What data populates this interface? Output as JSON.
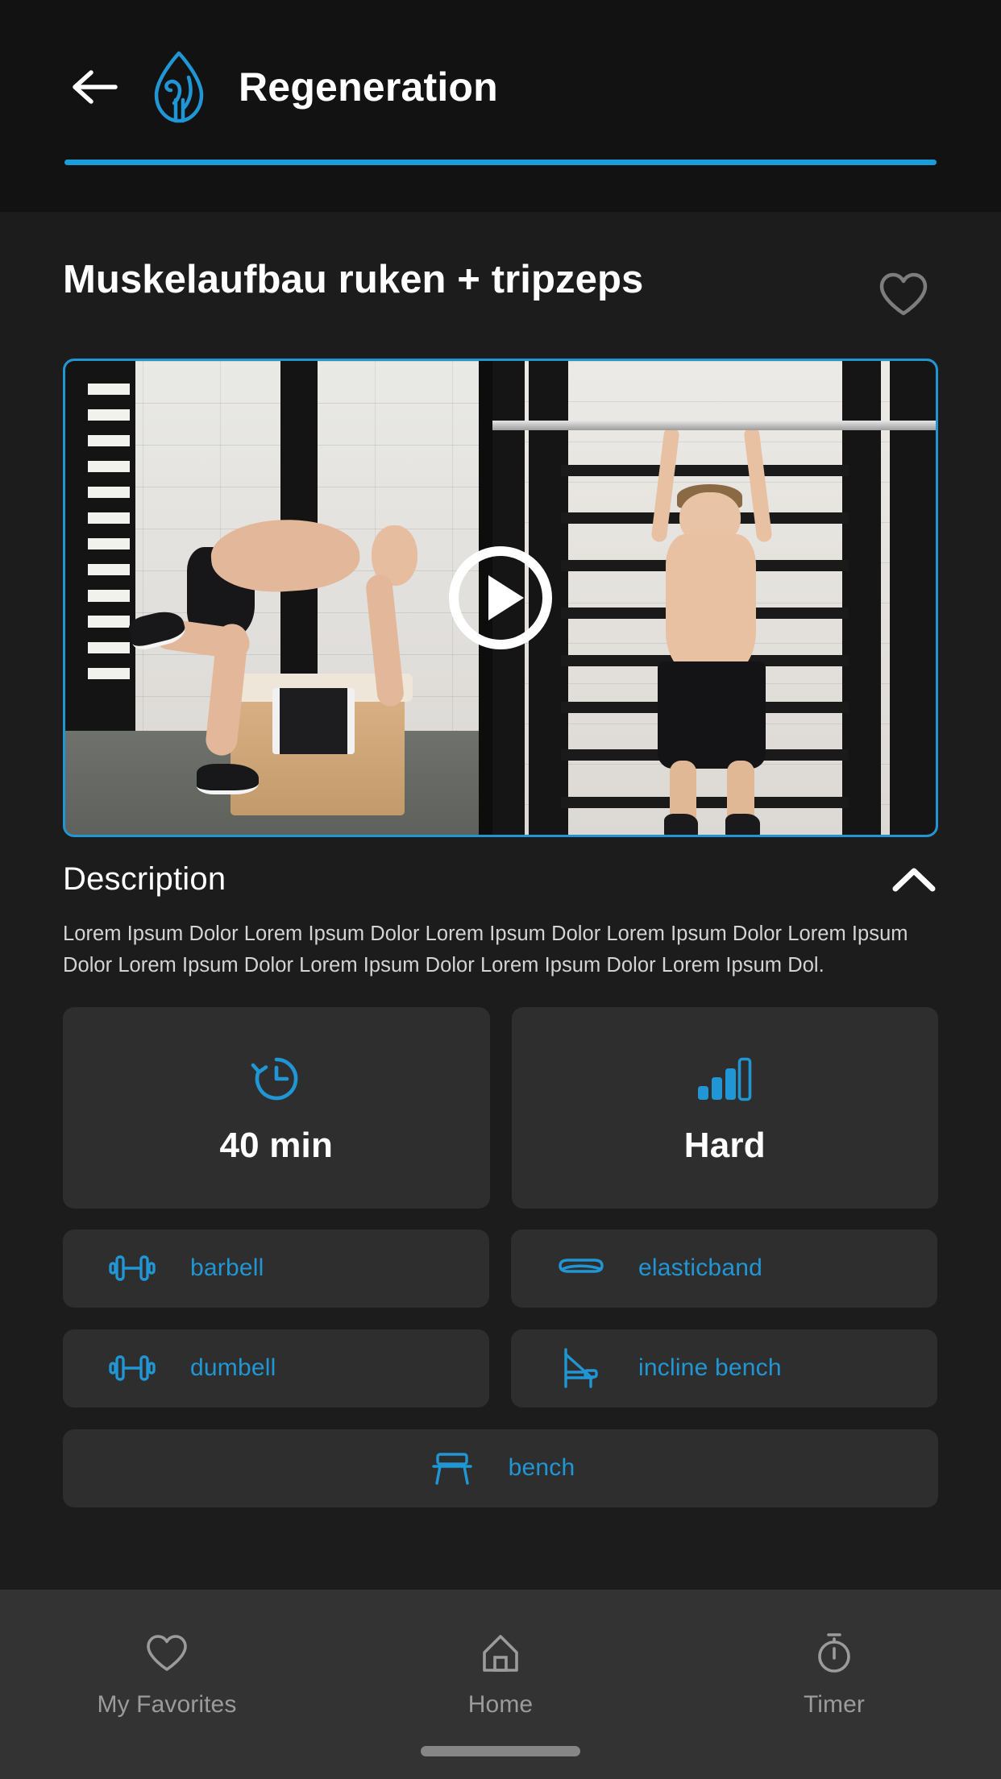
{
  "theme": {
    "accent": "#2196d4",
    "header_bg": "#121212",
    "page_bg": "#1c1c1c",
    "card_bg": "#2e2e2e",
    "nav_bg": "#333333",
    "text_primary": "#ffffff",
    "text_muted": "#9b9b9b"
  },
  "header": {
    "back_icon": "arrow-left-icon",
    "logo_icon": "flame-logo-icon",
    "title": "Regeneration"
  },
  "workout": {
    "title": "Muskelaufbau ruken + tripzeps",
    "favorite_icon": "heart-outline-icon",
    "favorited": false,
    "video": {
      "play_icon": "play-circle-icon",
      "alt": "Two-up gym exercise demonstration video"
    }
  },
  "description": {
    "heading": "Description",
    "expanded": true,
    "toggle_icon": "chevron-up-icon",
    "text": "Lorem Ipsum Dolor Lorem Ipsum Dolor Lorem Ipsum Dolor Lorem Ipsum Dolor Lorem Ipsum Dolor Lorem Ipsum Dolor Lorem Ipsum Dolor Lorem Ipsum Dolor Lorem Ipsum Dol."
  },
  "stats": [
    {
      "icon": "clock-history-icon",
      "value": "40 min",
      "kind": "duration"
    },
    {
      "icon": "signal-bars-icon",
      "value": "Hard",
      "kind": "difficulty"
    }
  ],
  "equipment": [
    {
      "icon": "barbell-icon",
      "label": "barbell",
      "full": false
    },
    {
      "icon": "elasticband-icon",
      "label": "elasticband",
      "full": false
    },
    {
      "icon": "dumbbell-icon",
      "label": "dumbell",
      "full": false
    },
    {
      "icon": "incline-bench-icon",
      "label": "incline bench",
      "full": false
    },
    {
      "icon": "bench-icon",
      "label": "bench",
      "full": true
    }
  ],
  "bottom_nav": [
    {
      "icon": "heart-outline-icon",
      "label": "My Favorites",
      "active": false
    },
    {
      "icon": "home-icon",
      "label": "Home",
      "active": false
    },
    {
      "icon": "stopwatch-icon",
      "label": "Timer",
      "active": false
    }
  ]
}
